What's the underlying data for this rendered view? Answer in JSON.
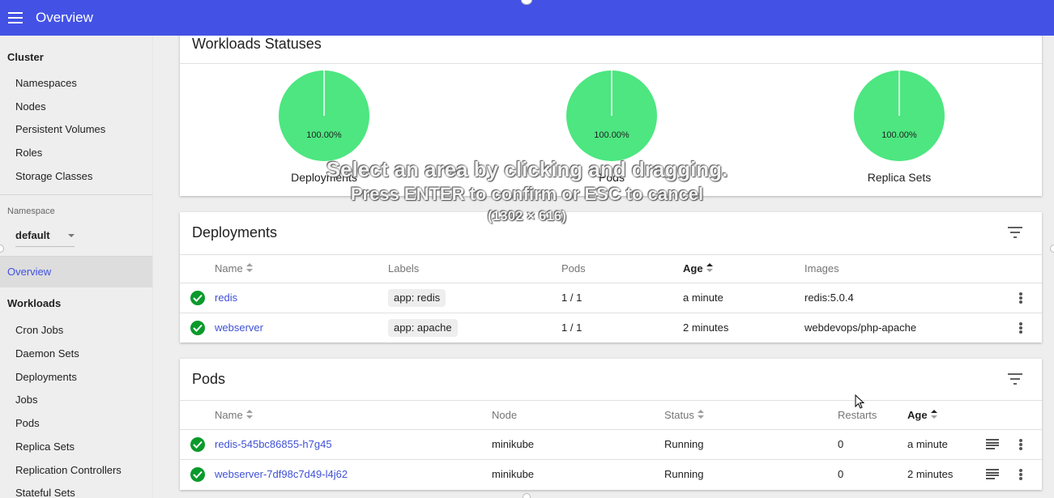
{
  "topbar": {
    "title": "Overview",
    "menu_icon": "menu-icon"
  },
  "sidebar": {
    "cluster_header": "Cluster",
    "cluster_items": [
      "Namespaces",
      "Nodes",
      "Persistent Volumes",
      "Roles",
      "Storage Classes"
    ],
    "namespace_label": "Namespace",
    "namespace_value": "default",
    "active_item": "Overview",
    "workloads_header": "Workloads",
    "workload_items": [
      "Cron Jobs",
      "Daemon Sets",
      "Deployments",
      "Jobs",
      "Pods",
      "Replica Sets",
      "Replication Controllers",
      "Stateful Sets"
    ]
  },
  "workloads_statuses": {
    "title": "Workloads Statuses",
    "charts": [
      {
        "label": "Deployments",
        "percent": "100.00%",
        "value": 100,
        "color": "#4de680"
      },
      {
        "label": "Pods",
        "percent": "100.00%",
        "value": 100,
        "color": "#4de680"
      },
      {
        "label": "Replica Sets",
        "percent": "100.00%",
        "value": 100,
        "color": "#4de680"
      }
    ]
  },
  "deployments": {
    "title": "Deployments",
    "columns": [
      "Name",
      "Labels",
      "Pods",
      "Age",
      "Images"
    ],
    "rows": [
      {
        "name": "redis",
        "label": "app: redis",
        "pods": "1 / 1",
        "age": "a minute",
        "image": "redis:5.0.4"
      },
      {
        "name": "webserver",
        "label": "app: apache",
        "pods": "1 / 1",
        "age": "2 minutes",
        "image": "webdevops/php-apache"
      }
    ]
  },
  "pods": {
    "title": "Pods",
    "columns": [
      "Name",
      "Node",
      "Status",
      "Restarts",
      "Age"
    ],
    "rows": [
      {
        "name": "redis-545bc86855-h7g45",
        "node": "minikube",
        "status": "Running",
        "restarts": "0",
        "age": "a minute"
      },
      {
        "name": "webserver-7df98c7d49-l4j62",
        "node": "minikube",
        "status": "Running",
        "restarts": "0",
        "age": "2 minutes"
      }
    ]
  },
  "overlay": {
    "line1": "Select an area by clicking and dragging.",
    "line2": "Press ENTER to confirm or ESC to cancel",
    "line3": "(1302 × 616)"
  },
  "colors": {
    "accent": "#4352e5",
    "success": "#0a9a2b",
    "pie": "#4de680",
    "link": "#3f51d5"
  }
}
